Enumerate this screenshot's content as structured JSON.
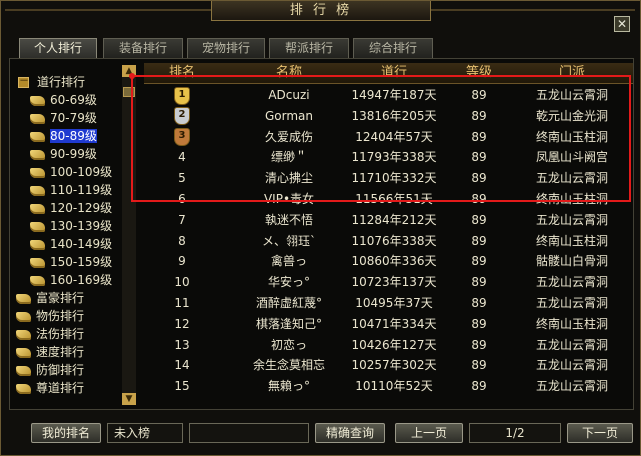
{
  "window": {
    "title": "排 行 榜",
    "close_glyph": "✕"
  },
  "tabs": [
    {
      "label": "个人排行",
      "active": true
    },
    {
      "label": "装备排行",
      "active": false
    },
    {
      "label": "宠物排行",
      "active": false
    },
    {
      "label": "帮派排行",
      "active": false
    },
    {
      "label": "综合排行",
      "active": false
    }
  ],
  "sidebar": {
    "group_label": "道行排行",
    "collapse_glyph": "－",
    "sub_items": [
      "60-69级",
      "70-79级",
      "80-89级",
      "90-99级",
      "100-109级",
      "110-119级",
      "120-129级",
      "130-139级",
      "140-149级",
      "150-159级",
      "160-169级"
    ],
    "selected": "80-89级",
    "top_items": [
      "富豪排行",
      "物伤排行",
      "法伤排行",
      "速度排行",
      "防御排行",
      "尊道排行"
    ],
    "scroll_up": "▲",
    "scroll_down": "▼"
  },
  "table": {
    "headers": [
      "排名",
      "名称",
      "道行",
      "等级",
      "门派"
    ],
    "rows": [
      {
        "rank": "1",
        "name": "ADcuzi",
        "daohang": "14947年187天",
        "level": "89",
        "sect": "五龙山云霄洞"
      },
      {
        "rank": "2",
        "name": "Gorman",
        "daohang": "13816年205天",
        "level": "89",
        "sect": "乾元山金光洞"
      },
      {
        "rank": "3",
        "name": "久爱成伤",
        "daohang": "12404年57天",
        "level": "89",
        "sect": "终南山玉柱洞"
      },
      {
        "rank": "4",
        "name": "缥缈＂",
        "daohang": "11793年338天",
        "level": "89",
        "sect": "凤凰山斗阙宫"
      },
      {
        "rank": "5",
        "name": "清心拂尘",
        "daohang": "11710年332天",
        "level": "89",
        "sect": "五龙山云霄洞"
      },
      {
        "rank": "6",
        "name": "VIP•毒女",
        "daohang": "11566年51天",
        "level": "89",
        "sect": "终南山玉柱洞"
      },
      {
        "rank": "7",
        "name": "執迷不悟",
        "daohang": "11284年212天",
        "level": "89",
        "sect": "五龙山云霄洞"
      },
      {
        "rank": "8",
        "name": "メ、翎珏ˋ",
        "daohang": "11076年338天",
        "level": "89",
        "sect": "终南山玉柱洞"
      },
      {
        "rank": "9",
        "name": "禽兽っ",
        "daohang": "10860年336天",
        "level": "89",
        "sect": "骷髅山白骨洞"
      },
      {
        "rank": "10",
        "name": "华安っ°",
        "daohang": "10723年137天",
        "level": "89",
        "sect": "五龙山云霄洞"
      },
      {
        "rank": "11",
        "name": "酒醉虚紅蔑°",
        "daohang": "10495年37天",
        "level": "89",
        "sect": "五龙山云霄洞"
      },
      {
        "rank": "12",
        "name": "棋落逢知己°",
        "daohang": "10471年334天",
        "level": "89",
        "sect": "终南山玉柱洞"
      },
      {
        "rank": "13",
        "name": "初恋っ",
        "daohang": "10426年127天",
        "level": "89",
        "sect": "五龙山云霄洞"
      },
      {
        "rank": "14",
        "name": "余生念莫相忘",
        "daohang": "10257年302天",
        "level": "89",
        "sect": "五龙山云霄洞"
      },
      {
        "rank": "15",
        "name": "無賴っ°",
        "daohang": "10110年52天",
        "level": "89",
        "sect": "五龙山云霄洞"
      }
    ],
    "medal_colors": [
      "#e8c24a",
      "#c8ccd0",
      "#c07a3a"
    ]
  },
  "footer": {
    "my_rank_label": "我的排名",
    "my_rank_value": "未入榜",
    "search_placeholder": "",
    "search_button": "精确查询",
    "prev_button": "上一页",
    "page_indicator": "1/2",
    "next_button": "下一页"
  },
  "colors": {
    "highlight": "#e31a1a",
    "header_text": "#e8c070",
    "selected_bg": "#1f3ad0"
  }
}
